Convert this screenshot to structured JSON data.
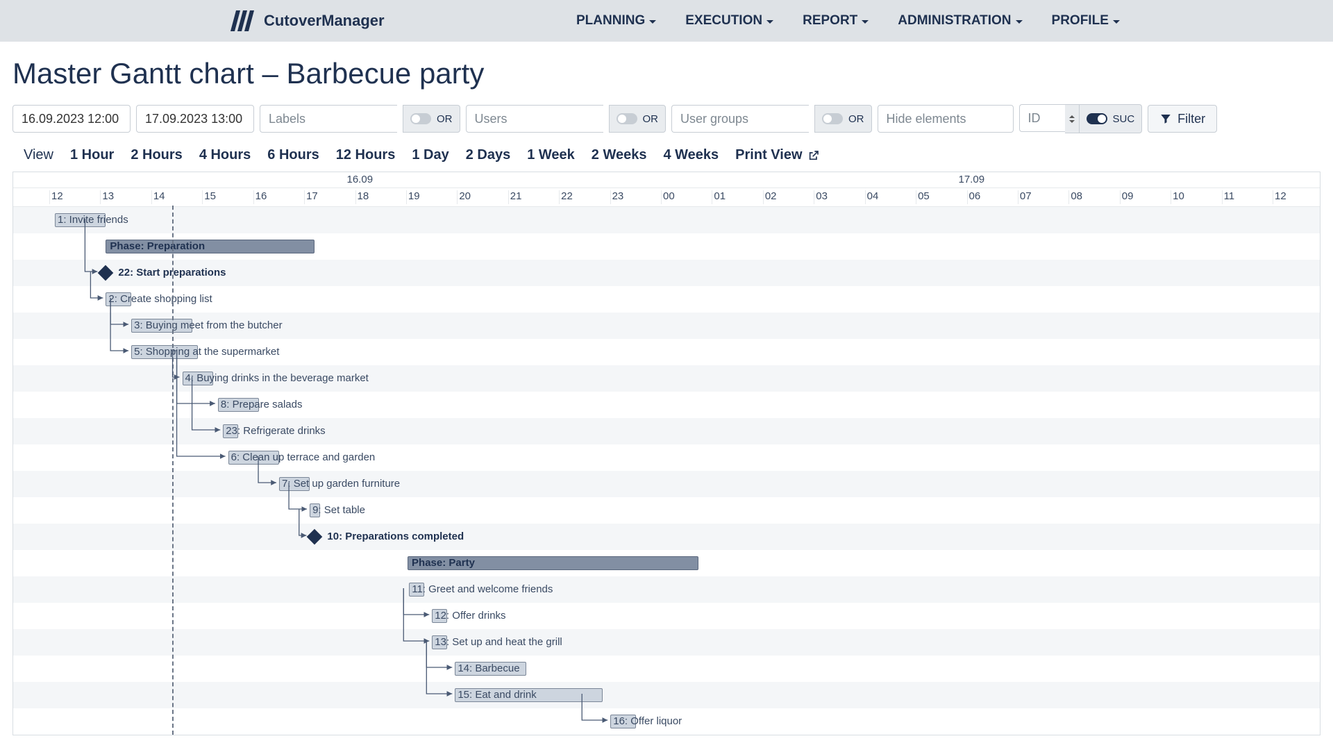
{
  "app": {
    "name": "CutoverManager"
  },
  "nav": {
    "items": [
      {
        "label": "PLANNING"
      },
      {
        "label": "EXECUTION"
      },
      {
        "label": "REPORT"
      },
      {
        "label": "ADMINISTRATION"
      },
      {
        "label": "PROFILE"
      }
    ]
  },
  "page": {
    "title": "Master Gantt chart  –  Barbecue party"
  },
  "filters": {
    "startDate": "16.09.2023 12:00",
    "endDate": "17.09.2023 13:00",
    "labelsPlaceholder": "Labels",
    "usersPlaceholder": "Users",
    "groupsPlaceholder": "User groups",
    "hidePlaceholder": "Hide elements",
    "idPlaceholder": "ID",
    "or": "OR",
    "suc": "SUC",
    "filterBtn": "Filter"
  },
  "viewBar": {
    "label": "View",
    "options": [
      "1 Hour",
      "2 Hours",
      "4 Hours",
      "6 Hours",
      "12 Hours",
      "1 Day",
      "2 Days",
      "1 Week",
      "2 Weeks",
      "4 Weeks"
    ],
    "print": "Print View"
  },
  "gantt": {
    "dates": [
      "16.09",
      "17.09"
    ],
    "hours": [
      "12",
      "13",
      "14",
      "15",
      "16",
      "17",
      "18",
      "19",
      "20",
      "21",
      "22",
      "23",
      "00",
      "01",
      "02",
      "03",
      "04",
      "05",
      "06",
      "07",
      "08",
      "09",
      "10",
      "11",
      "12"
    ],
    "tasks": [
      {
        "id": 1,
        "label": "1: Invite friends",
        "type": "task",
        "start": 0.0,
        "dur": 1.0
      },
      {
        "id": null,
        "label": "Phase: Preparation",
        "type": "phase",
        "start": 1.0,
        "dur": 4.1
      },
      {
        "id": 22,
        "label": "22: Start preparations",
        "type": "milestone",
        "start": 1.0
      },
      {
        "id": 2,
        "label": "2: Create shopping list",
        "type": "task",
        "start": 1.0,
        "dur": 0.5
      },
      {
        "id": 3,
        "label": "3: Buying meet from the butcher",
        "type": "task",
        "start": 1.5,
        "dur": 1.2
      },
      {
        "id": 5,
        "label": "5: Shopping at the supermarket",
        "type": "task",
        "start": 1.5,
        "dur": 1.3
      },
      {
        "id": 4,
        "label": "4: Buying drinks in the beverage market",
        "type": "task",
        "start": 2.5,
        "dur": 0.6
      },
      {
        "id": 8,
        "label": "8: Prepare salads",
        "type": "task",
        "start": 3.2,
        "dur": 0.8
      },
      {
        "id": 23,
        "label": "23: Refrigerate drinks",
        "type": "task",
        "start": 3.3,
        "dur": 0.3
      },
      {
        "id": 6,
        "label": "6: Clean up terrace and garden",
        "type": "task",
        "start": 3.4,
        "dur": 1.0
      },
      {
        "id": 7,
        "label": "7: Set up garden furniture",
        "type": "task",
        "start": 4.4,
        "dur": 0.6
      },
      {
        "id": 9,
        "label": "9: Set table",
        "type": "task",
        "start": 5.0,
        "dur": 0.2
      },
      {
        "id": 10,
        "label": "10: Preparations completed",
        "type": "milestone",
        "start": 5.1
      },
      {
        "id": null,
        "label": "Phase: Party",
        "type": "phase",
        "start": 6.92,
        "dur": 5.7
      },
      {
        "id": 11,
        "label": "11: Greet and welcome friends",
        "type": "task",
        "start": 6.95,
        "dur": 0.3
      },
      {
        "id": 12,
        "label": "12: Offer drinks",
        "type": "task",
        "start": 7.4,
        "dur": 0.3
      },
      {
        "id": 13,
        "label": "13: Set up and heat the grill",
        "type": "task",
        "start": 7.4,
        "dur": 0.3
      },
      {
        "id": 14,
        "label": "14: Barbecue",
        "type": "task",
        "start": 7.85,
        "dur": 1.4
      },
      {
        "id": 15,
        "label": "15: Eat and drink",
        "type": "task",
        "start": 7.85,
        "dur": 2.9
      },
      {
        "id": 16,
        "label": "16: Offer liquor",
        "type": "task",
        "start": 10.9,
        "dur": 0.5
      }
    ],
    "nowAtHourOffset": 2.3,
    "connectors": [
      {
        "from": 0,
        "to": 2
      },
      {
        "from": 2,
        "to": 3
      },
      {
        "from": 3,
        "to": 4
      },
      {
        "from": 3,
        "to": 5
      },
      {
        "from": 5,
        "to": 6
      },
      {
        "from": 5,
        "to": 7
      },
      {
        "from": 6,
        "to": 8
      },
      {
        "from": 5,
        "to": 9
      },
      {
        "from": 9,
        "to": 10
      },
      {
        "from": 10,
        "to": 11
      },
      {
        "from": 11,
        "to": 12
      },
      {
        "from": 14,
        "to": 15
      },
      {
        "from": 14,
        "to": 16
      },
      {
        "from": 16,
        "to": 17
      },
      {
        "from": 16,
        "to": 18
      },
      {
        "from": 18,
        "to": 19
      }
    ]
  }
}
